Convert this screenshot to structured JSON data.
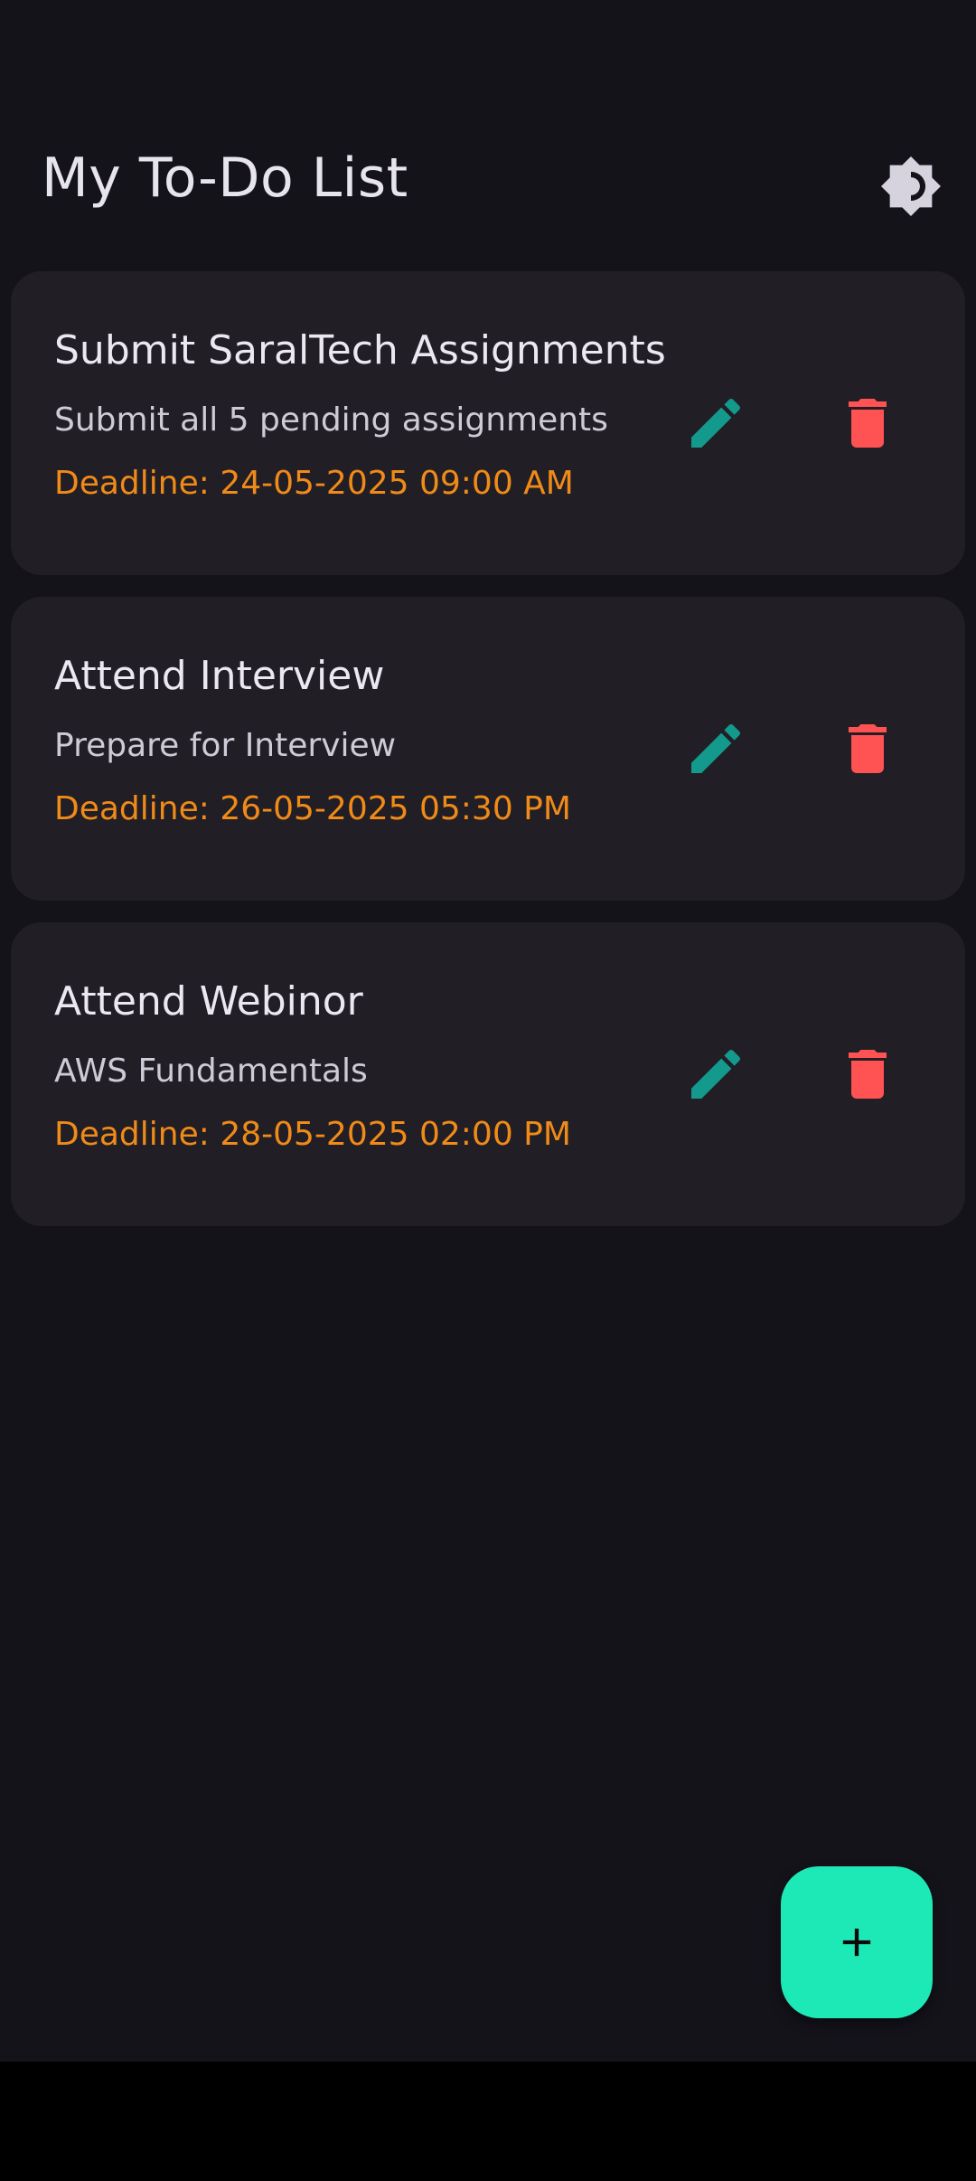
{
  "app": {
    "title": "My To-Do List",
    "theme_toggle_icon": "brightness-contrast-icon"
  },
  "colors": {
    "background": "#15131a",
    "card": "#211f25",
    "title_text": "#ece8f1",
    "description_text": "#cfcbd6",
    "deadline_text": "#f08a18",
    "edit_icon": "#139a8c",
    "delete_icon": "#ff5252",
    "fab": "#1de9b6"
  },
  "tasks": [
    {
      "title": "Submit SaralTech Assignments",
      "description": "Submit all 5 pending assignments",
      "deadline": "Deadline: 24-05-2025 09:00 AM"
    },
    {
      "title": "Attend Interview",
      "description": "Prepare for Interview",
      "deadline": "Deadline: 26-05-2025 05:30 PM"
    },
    {
      "title": "Attend Webinor",
      "description": "AWS Fundamentals",
      "deadline": "Deadline: 28-05-2025 02:00 PM"
    }
  ],
  "actions": {
    "edit_icon": "pencil-icon",
    "delete_icon": "trash-icon",
    "fab_icon": "plus-icon"
  }
}
